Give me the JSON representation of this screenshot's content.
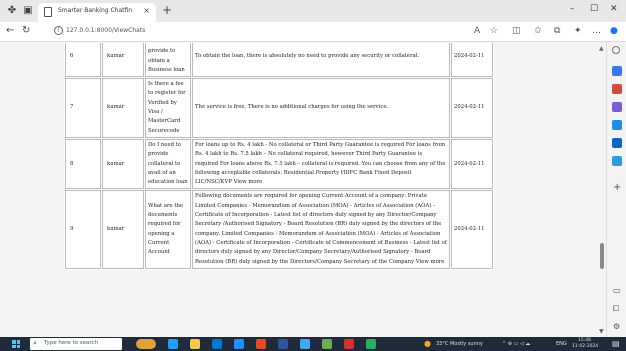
{
  "browser": {
    "tab_title": "Smarter Banking Chatfin",
    "tab_close": "×",
    "new_tab": "+",
    "url": "127.0.0.1:8000/ViewChats",
    "window_min": "–",
    "window_max": "☐",
    "window_close": "✕"
  },
  "table": {
    "rows": [
      {
        "num": "6",
        "user": "kumar",
        "question": "do I need to provide to obtain a Business loan",
        "answer": "To obtain the loan, there is absolutely no need to provide any security or collateral.",
        "date": "2024-02-11"
      },
      {
        "num": "7",
        "user": "kumar",
        "question": "Is there a fee to register for Verified by Visa / MasterCard Securecode",
        "answer": "The service is free, There is no additional charges for using the service.",
        "date": "2024-02-11"
      },
      {
        "num": "8",
        "user": "kumar",
        "question": "Do I need to provide collateral to avail of an education loan",
        "answer": "For loans up to Rs. 4 lakh - No collateral or Third Party Guarantee is required For loans from Rs. 4 lakh to Rs. 7.5 lakh – No collateral required, however Third Party Guarantee is required For loans above Rs. 7.5 lakh – collateral is required. You can choose from any of the following acceptable collaterals: Residential Property HDFC Bank Fixed Deposit LIC/NSC/KVP View more",
        "date": "2024-02-11"
      },
      {
        "num": "9",
        "user": "kumar",
        "question": "What are the documents required for opening a Current Account",
        "answer": "Following documents are required for opening Current Account of a company: Private Limited Companies - Memorandum of Association (MOA) - Articles of Association (AOA) - Certificate of Incorporation - Latest list of directors duly signed by any Director/Company Secretary /Authorised Signatory - Board Resolution (BR) duly signed by the directors of the company. Limited Companies - Memorandum of Association (MOA) - Articles of Association (AOA) - Certificate of Incorporation - Certificate of Commencement of Business - Latest list of directors duly signed by any Director/Company Secretary/Authorised Signatory - Board Resolution (BR) duly signed by the Directors/Company Secretary of the Company View more",
        "date": "2024-02-11"
      }
    ]
  },
  "taskbar": {
    "search_placeholder": "Type here to search",
    "weather": "33°C  Mostly sunny",
    "lang": "ENG",
    "time": "15:48",
    "date": "11-02-2024"
  }
}
